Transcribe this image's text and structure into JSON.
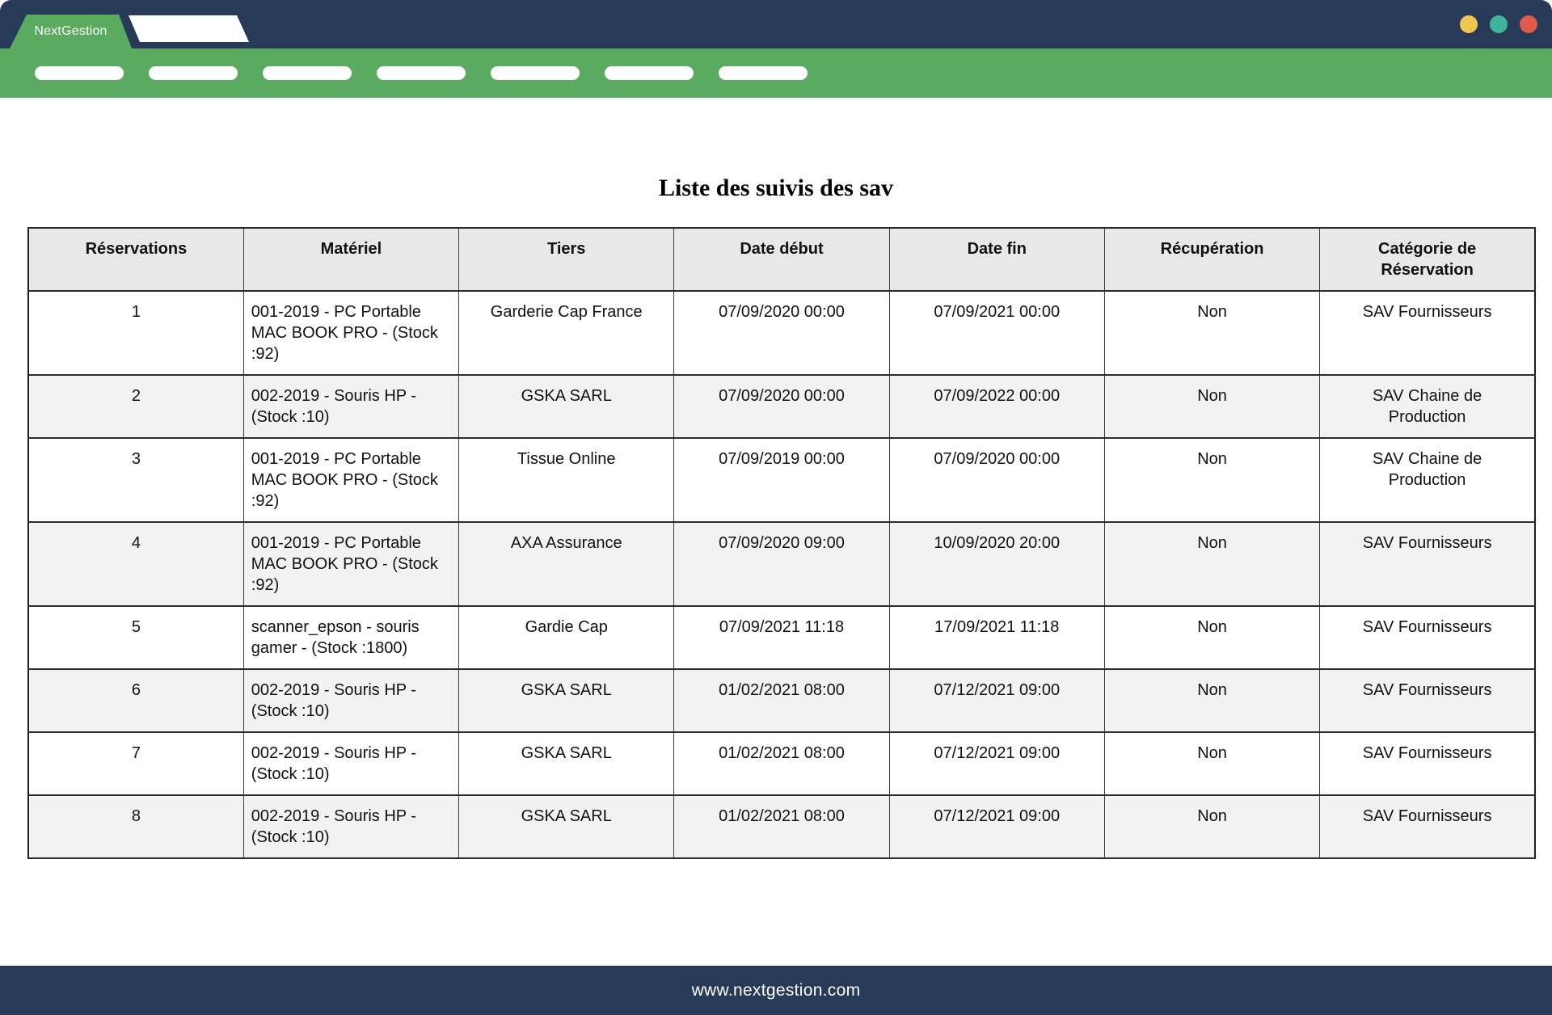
{
  "browser_frame": {
    "brand_tab_label": "NextGestion",
    "window_dots": [
      {
        "name": "window-dot-yellow",
        "color": "#f0c64f"
      },
      {
        "name": "window-dot-teal",
        "color": "#3eb59b"
      },
      {
        "name": "window-dot-red",
        "color": "#e05c4a"
      }
    ],
    "nav_pills_count": 7
  },
  "report": {
    "title": "Liste des suivis des sav",
    "table": {
      "columns": [
        "Réservations",
        "Matériel",
        "Tiers",
        "Date début",
        "Date fin",
        "Récupération",
        "Catégorie de Réservation"
      ],
      "rows": [
        [
          "1",
          "001-2019 - PC Portable MAC BOOK PRO - (Stock :92)",
          "Garderie Cap France",
          "07/09/2020 00:00",
          "07/09/2021 00:00",
          "Non",
          "SAV Fournisseurs"
        ],
        [
          "2",
          "002-2019 - Souris HP - (Stock :10)",
          "GSKA SARL",
          "07/09/2020 00:00",
          "07/09/2022 00:00",
          "Non",
          "SAV Chaine de Production"
        ],
        [
          "3",
          "001-2019 - PC Portable MAC BOOK PRO - (Stock :92)",
          "Tissue Online",
          "07/09/2019 00:00",
          "07/09/2020 00:00",
          "Non",
          "SAV Chaine de Production"
        ],
        [
          "4",
          "001-2019 - PC Portable MAC BOOK PRO - (Stock :92)",
          "AXA Assurance",
          "07/09/2020 09:00",
          "10/09/2020 20:00",
          "Non",
          "SAV Fournisseurs"
        ],
        [
          "5",
          "scanner_epson - souris gamer - (Stock :1800)",
          "Gardie Cap",
          "07/09/2021 11:18",
          "17/09/2021 11:18",
          "Non",
          "SAV Fournisseurs"
        ],
        [
          "6",
          "002-2019 - Souris HP - (Stock :10)",
          "GSKA SARL",
          "01/02/2021 08:00",
          "07/12/2021 09:00",
          "Non",
          "SAV Fournisseurs"
        ],
        [
          "7",
          "002-2019 - Souris HP - (Stock :10)",
          "GSKA SARL",
          "01/02/2021 08:00",
          "07/12/2021 09:00",
          "Non",
          "SAV Fournisseurs"
        ],
        [
          "8",
          "002-2019 - Souris HP - (Stock :10)",
          "GSKA SARL",
          "01/02/2021 08:00",
          "07/12/2021 09:00",
          "Non",
          "SAV Fournisseurs"
        ]
      ]
    }
  },
  "footer": {
    "url": "www.nextgestion.com"
  },
  "colors": {
    "navy": "#273a57",
    "green": "#5aab5f",
    "table_header_bg": "#e8e8e8",
    "zebra_row_bg": "#f2f2f2"
  }
}
